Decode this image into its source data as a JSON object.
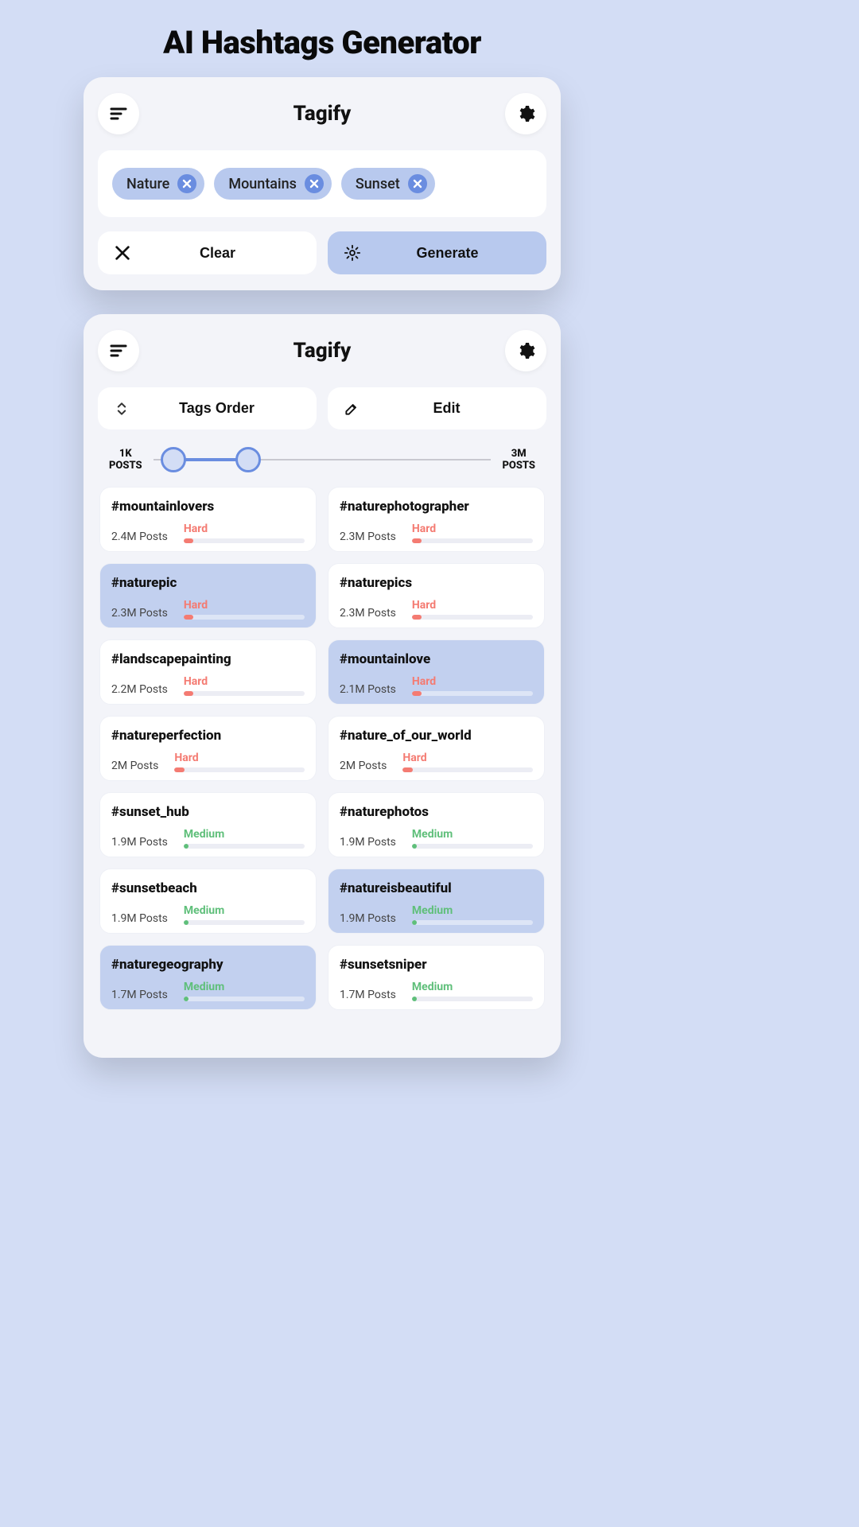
{
  "page_title": "AI Hashtags Generator",
  "app_title": "Tagify",
  "input_card": {
    "tags": [
      "Nature",
      "Mountains",
      "Sunset"
    ],
    "clear_label": "Clear",
    "generate_label": "Generate"
  },
  "results_card": {
    "tags_order_label": "Tags Order",
    "edit_label": "Edit",
    "slider_min": "1K\nPOSTS",
    "slider_max": "3M\nPOSTS",
    "hashtags": [
      {
        "name": "#mountainlovers",
        "posts": "2.4M Posts",
        "difficulty": "Hard",
        "selected": false
      },
      {
        "name": "#naturephotographer",
        "posts": "2.3M Posts",
        "difficulty": "Hard",
        "selected": false
      },
      {
        "name": "#naturepic",
        "posts": "2.3M Posts",
        "difficulty": "Hard",
        "selected": true
      },
      {
        "name": "#naturepics",
        "posts": "2.3M Posts",
        "difficulty": "Hard",
        "selected": false
      },
      {
        "name": "#landscapepainting",
        "posts": "2.2M Posts",
        "difficulty": "Hard",
        "selected": false
      },
      {
        "name": "#mountainlove",
        "posts": "2.1M Posts",
        "difficulty": "Hard",
        "selected": true
      },
      {
        "name": "#natureperfection",
        "posts": "2M Posts",
        "difficulty": "Hard",
        "selected": false
      },
      {
        "name": "#nature_of_our_world",
        "posts": "2M Posts",
        "difficulty": "Hard",
        "selected": false
      },
      {
        "name": "#sunset_hub",
        "posts": "1.9M Posts",
        "difficulty": "Medium",
        "selected": false
      },
      {
        "name": "#naturephotos",
        "posts": "1.9M Posts",
        "difficulty": "Medium",
        "selected": false
      },
      {
        "name": "#sunsetbeach",
        "posts": "1.9M Posts",
        "difficulty": "Medium",
        "selected": false
      },
      {
        "name": "#natureisbeautiful",
        "posts": "1.9M Posts",
        "difficulty": "Medium",
        "selected": true
      },
      {
        "name": "#naturegeography",
        "posts": "1.7M Posts",
        "difficulty": "Medium",
        "selected": true
      },
      {
        "name": "#sunsetsniper",
        "posts": "1.7M Posts",
        "difficulty": "Medium",
        "selected": false
      }
    ]
  }
}
